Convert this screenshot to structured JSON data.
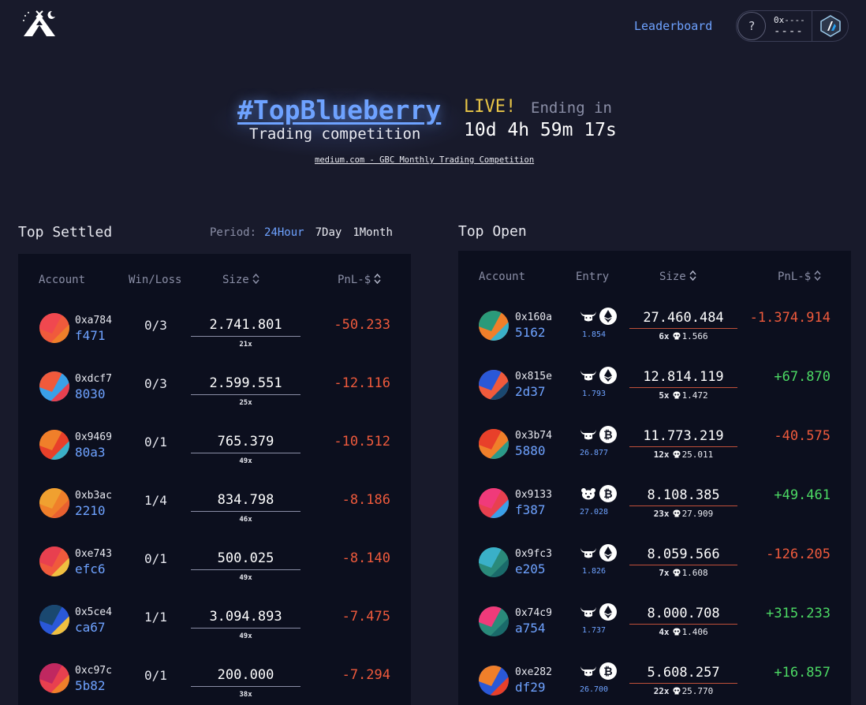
{
  "header": {
    "leaderboard_label": "Leaderboard",
    "help_label": "?",
    "account_line1": "0x----",
    "account_line2": "----",
    "logo_icon": "teepee-logo-icon",
    "network_icon": "arbitrum-network-icon"
  },
  "hero": {
    "title": "#TopBlueberry",
    "subtitle": "Trading competition",
    "live_label": "LIVE!",
    "ending_label": "Ending in",
    "countdown": "10d 4h 59m 17s",
    "link_text": "medium.com - GBC Monthly Trading Competition"
  },
  "settled": {
    "title": "Top Settled",
    "period_label": "Period:",
    "periods": [
      "24Hour",
      "7Day",
      "1Month"
    ],
    "active_period": "24Hour",
    "columns": [
      "Account",
      "Win/Loss",
      "Size",
      "PnL-$"
    ],
    "rows": [
      {
        "addr1": "0xa784",
        "addr2": "f471",
        "wl": "0/3",
        "size": "2.741.801",
        "lev": "21x",
        "pnl": "-50.233",
        "colors": [
          "#f05a3c",
          "#f0484f",
          "#f07f2a"
        ]
      },
      {
        "addr1": "0xdcf7",
        "addr2": "8030",
        "wl": "0/3",
        "size": "2.599.551",
        "lev": "25x",
        "pnl": "-12.116",
        "colors": [
          "#3aa0e8",
          "#f05a3c",
          "#e8404f"
        ]
      },
      {
        "addr1": "0x9469",
        "addr2": "80a3",
        "wl": "0/1",
        "size": "765.379",
        "lev": "49x",
        "pnl": "-10.512",
        "colors": [
          "#e8402a",
          "#f07f2a",
          "#3ab0c8"
        ]
      },
      {
        "addr1": "0xb3ac",
        "addr2": "2210",
        "wl": "1/4",
        "size": "834.798",
        "lev": "46x",
        "pnl": "-8.186",
        "colors": [
          "#f07f2a",
          "#f0a030",
          "#e86030"
        ]
      },
      {
        "addr1": "0xe743",
        "addr2": "efc6",
        "wl": "0/1",
        "size": "500.025",
        "lev": "49x",
        "pnl": "-8.140",
        "colors": [
          "#f05a3c",
          "#e8404f",
          "#f0c040"
        ]
      },
      {
        "addr1": "0x5ce4",
        "addr2": "ca67",
        "wl": "1/1",
        "size": "3.094.893",
        "lev": "49x",
        "pnl": "-7.475",
        "colors": [
          "#2a58d8",
          "#1a4870",
          "#f0c040"
        ]
      },
      {
        "addr1": "0xc97c",
        "addr2": "5b82",
        "wl": "0/1",
        "size": "200.000",
        "lev": "38x",
        "pnl": "-7.294",
        "colors": [
          "#e8404f",
          "#c02860",
          "#f07f2a"
        ]
      }
    ]
  },
  "open": {
    "title": "Top Open",
    "columns": [
      "Account",
      "Entry",
      "Size",
      "PnL-$"
    ],
    "rows": [
      {
        "addr1": "0x160a",
        "addr2": "5162",
        "asset": "ETH",
        "side": "bull",
        "entry": "1.854",
        "size": "27.460.484",
        "lev": "6x",
        "liq": "1.566",
        "pnl": "-1.374.914",
        "positive": false,
        "colors": [
          "#f07f2a",
          "#2a9a7a",
          "#3ab0c8"
        ]
      },
      {
        "addr1": "0x815e",
        "addr2": "2d37",
        "asset": "ETH",
        "side": "bull",
        "entry": "1.793",
        "size": "12.814.119",
        "lev": "5x",
        "liq": "1.472",
        "pnl": "+67.870",
        "positive": true,
        "colors": [
          "#f05a3c",
          "#2a58d8",
          "#1a4870"
        ]
      },
      {
        "addr1": "0x3b74",
        "addr2": "5880",
        "asset": "BTC",
        "side": "bull",
        "entry": "26.877",
        "size": "11.773.219",
        "lev": "12x",
        "liq": "25.011",
        "pnl": "-40.575",
        "positive": false,
        "colors": [
          "#f07f2a",
          "#e8402a",
          "#2a9a8a"
        ]
      },
      {
        "addr1": "0x9133",
        "addr2": "f387",
        "asset": "BTC",
        "side": "bear",
        "entry": "27.028",
        "size": "8.108.385",
        "lev": "23x",
        "liq": "27.909",
        "pnl": "+49.461",
        "positive": true,
        "colors": [
          "#e8404f",
          "#f03a7a",
          "#3aa0e8"
        ]
      },
      {
        "addr1": "0x9fc3",
        "addr2": "e205",
        "asset": "ETH",
        "side": "bull",
        "entry": "1.826",
        "size": "8.059.566",
        "lev": "7x",
        "liq": "1.608",
        "pnl": "-126.205",
        "positive": false,
        "colors": [
          "#2a8a7a",
          "#3ab0c8",
          "#1a6a6a"
        ]
      },
      {
        "addr1": "0x74c9",
        "addr2": "a754",
        "asset": "ETH",
        "side": "bull",
        "entry": "1.737",
        "size": "8.000.708",
        "lev": "4x",
        "liq": "1.406",
        "pnl": "+315.233",
        "positive": true,
        "colors": [
          "#2a8a7a",
          "#f03a7a",
          "#1a6a6a"
        ]
      },
      {
        "addr1": "0xe282",
        "addr2": "df29",
        "asset": "BTC",
        "side": "bull",
        "entry": "26.700",
        "size": "5.608.257",
        "lev": "22x",
        "liq": "25.770",
        "pnl": "+16.857",
        "positive": true,
        "colors": [
          "#2a58d8",
          "#f07f2a",
          "#e8402a"
        ]
      }
    ]
  }
}
